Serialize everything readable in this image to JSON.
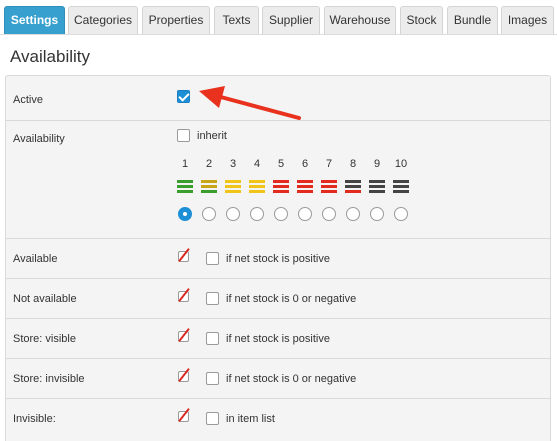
{
  "tabs": [
    {
      "label": "Settings",
      "active": true
    },
    {
      "label": "Categories",
      "active": false
    },
    {
      "label": "Properties",
      "active": false
    },
    {
      "label": "Texts",
      "active": false
    },
    {
      "label": "Supplier",
      "active": false
    },
    {
      "label": "Warehouse",
      "active": false
    },
    {
      "label": "Stock",
      "active": false
    },
    {
      "label": "Bundle",
      "active": false
    },
    {
      "label": "Images",
      "active": false
    }
  ],
  "section": {
    "title": "Availability"
  },
  "active_row": {
    "label": "Active",
    "checked": true
  },
  "availability": {
    "label": "Availability",
    "inherit_label": "inherit",
    "inherit_checked": false,
    "levels": [
      "1",
      "2",
      "3",
      "4",
      "5",
      "6",
      "7",
      "8",
      "9",
      "10"
    ],
    "level_colors": [
      "#3a9e2f",
      "#c7a516",
      "#f0c419",
      "#f0c419",
      "#e22a1e",
      "#e22a1e",
      "#e22a1e",
      "#444444",
      "#444444",
      "#444444"
    ],
    "level_secondary_colors": [
      "#3a9e2f",
      "#3a9e2f",
      "#f0c419",
      "#f0c419",
      "#e22a1e",
      "#e22a1e",
      "#e22a1e",
      "#e22a1e",
      "#444444",
      "#444444"
    ],
    "selected_level": "1"
  },
  "rows": [
    {
      "label": "Available",
      "option": "if net stock is positive"
    },
    {
      "label": "Not available",
      "option": "if net stock is 0 or negative"
    },
    {
      "label": "Store: visible",
      "option": "if net stock is positive"
    },
    {
      "label": "Store: invisible",
      "option": "if net stock is 0 or negative"
    },
    {
      "label": "Invisible:",
      "option": "in item list"
    }
  ],
  "colors": {
    "accent": "#37a0cf",
    "checkbox": "#1d8fd6",
    "arrow": "#e8321e"
  },
  "icons": {
    "inherit": "slashed-checkbox-icon",
    "annotation": "red-arrow"
  }
}
